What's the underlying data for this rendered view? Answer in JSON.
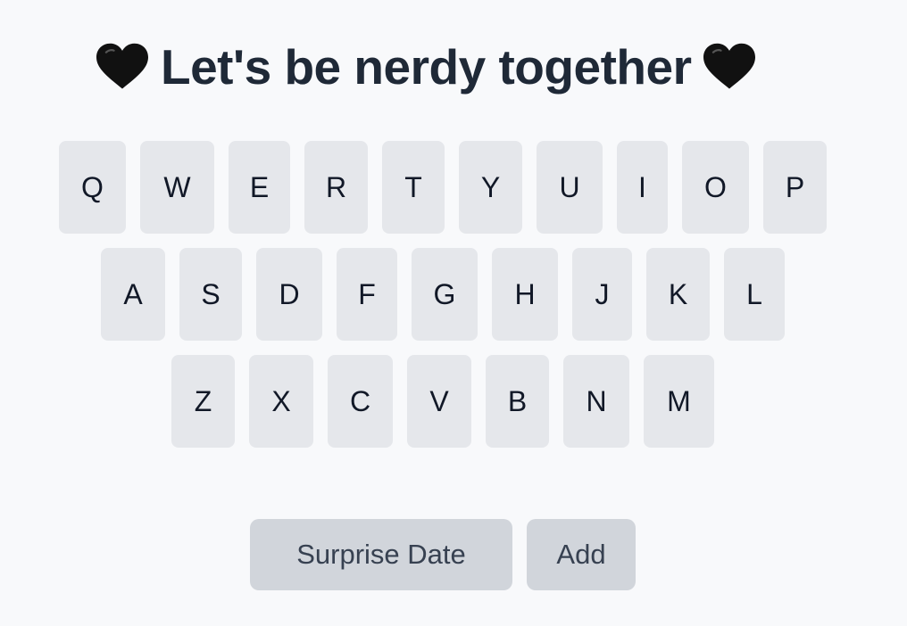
{
  "title": {
    "text": "Let's be nerdy together",
    "left_icon": "black-heart-icon",
    "right_icon": "black-heart-icon"
  },
  "keyboard": {
    "row1": [
      "Q",
      "W",
      "E",
      "R",
      "T",
      "Y",
      "U",
      "I",
      "O",
      "P"
    ],
    "row2": [
      "A",
      "S",
      "D",
      "F",
      "G",
      "H",
      "J",
      "K",
      "L"
    ],
    "row3": [
      "Z",
      "X",
      "C",
      "V",
      "B",
      "N",
      "M"
    ]
  },
  "actions": {
    "surprise_label": "Surprise Date",
    "add_label": "Add"
  },
  "colors": {
    "background": "#f8f9fb",
    "key": "#e5e7eb",
    "button": "#d1d5db",
    "text": "#1f2937"
  }
}
